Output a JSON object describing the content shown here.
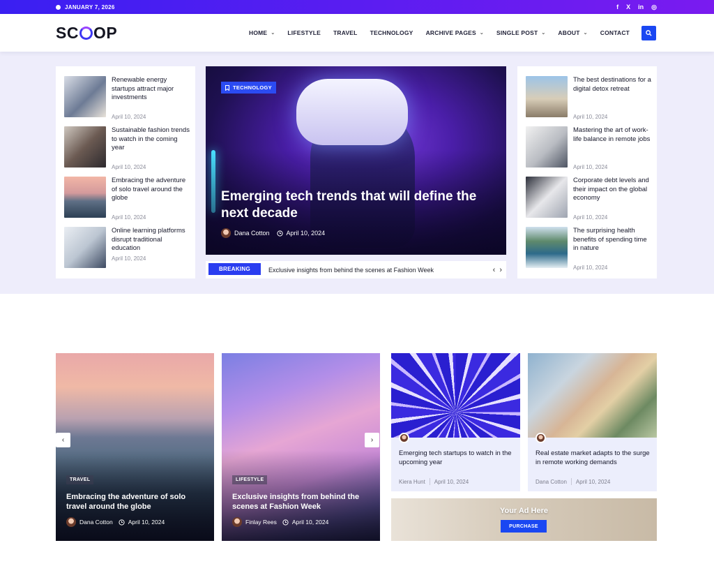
{
  "topbar": {
    "date": "JANUARY 7, 2026",
    "social": [
      "f",
      "X",
      "in",
      "◎"
    ]
  },
  "header": {
    "logo": {
      "left": "SC",
      "right": "OP"
    },
    "nav": [
      {
        "label": "HOME",
        "has_dropdown": true
      },
      {
        "label": "LIFESTYLE",
        "has_dropdown": false
      },
      {
        "label": "TRAVEL",
        "has_dropdown": false
      },
      {
        "label": "TECHNOLOGY",
        "has_dropdown": false
      },
      {
        "label": "ARCHIVE PAGES",
        "has_dropdown": true
      },
      {
        "label": "SINGLE POST",
        "has_dropdown": true
      },
      {
        "label": "ABOUT",
        "has_dropdown": true
      },
      {
        "label": "CONTACT",
        "has_dropdown": false
      }
    ],
    "search_icon": "search-icon"
  },
  "left_list": [
    {
      "title": "Renewable energy startups attract major investments",
      "date": "April 10, 2024"
    },
    {
      "title": "Sustainable fashion trends to watch in the coming year",
      "date": "April 10, 2024"
    },
    {
      "title": "Embracing the adventure of solo travel around the globe",
      "date": "April 10, 2024"
    },
    {
      "title": "Online learning platforms disrupt traditional education",
      "date": "April 10, 2024"
    }
  ],
  "right_list": [
    {
      "title": "The best destinations for a digital detox retreat",
      "date": "April 10, 2024"
    },
    {
      "title": "Mastering the art of work-life balance in remote jobs",
      "date": "April 10, 2024"
    },
    {
      "title": "Corporate debt levels and their impact on the global economy",
      "date": "April 10, 2024"
    },
    {
      "title": "The surprising health benefits of spending time in nature",
      "date": "April 10, 2024"
    }
  ],
  "feature": {
    "tag": "TECHNOLOGY",
    "title": "Emerging tech trends that will define the next decade",
    "author": "Dana Cotton",
    "date": "April 10, 2024"
  },
  "breaking": {
    "label": "BREAKING",
    "text": "Exclusive insights from behind the scenes at Fashion Week",
    "prev": "‹",
    "next": "›"
  },
  "big_cards": [
    {
      "tag": "TRAVEL",
      "title": "Embracing the adventure of solo travel around the globe",
      "author": "Dana Cotton",
      "date": "April 10, 2024"
    },
    {
      "tag": "LIFESTYLE",
      "title": "Exclusive insights from behind the scenes at Fashion Week",
      "author": "Finlay Rees",
      "date": "April 10, 2024"
    }
  ],
  "slider": {
    "prev": "‹",
    "next": "›"
  },
  "small_cards": [
    {
      "title": "Emerging tech startups to watch in the upcoming year",
      "author": "Kiera Hunt",
      "date": "April 10, 2024"
    },
    {
      "title": "Real estate market adapts to the surge in remote working demands",
      "author": "Dana Cotton",
      "date": "April 10, 2024"
    }
  ],
  "ad": {
    "title": "Your Ad Here",
    "button": "PURCHASE"
  },
  "colors": {
    "accent": "#1a47f2",
    "topbar_start": "#3a1ff2",
    "topbar_end": "#7a1bf0",
    "hero_bg": "#eeedfb"
  }
}
